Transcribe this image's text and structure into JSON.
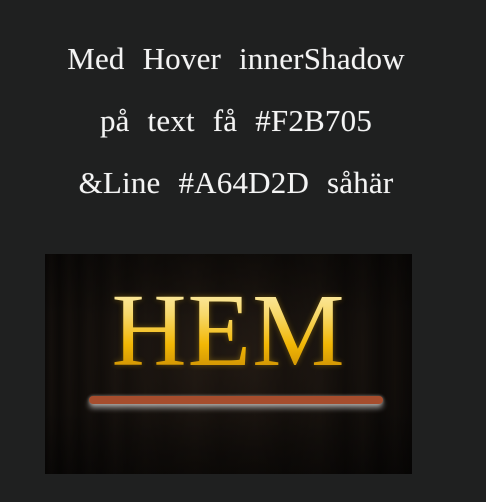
{
  "caption": {
    "lines": [
      "Med Hover innerShadow",
      "på text få #F2B705",
      "&Line #A64D2D såhär"
    ]
  },
  "preview": {
    "link_text": "HEM",
    "text_color": "#F2B705",
    "line_color": "#A64D2D"
  }
}
